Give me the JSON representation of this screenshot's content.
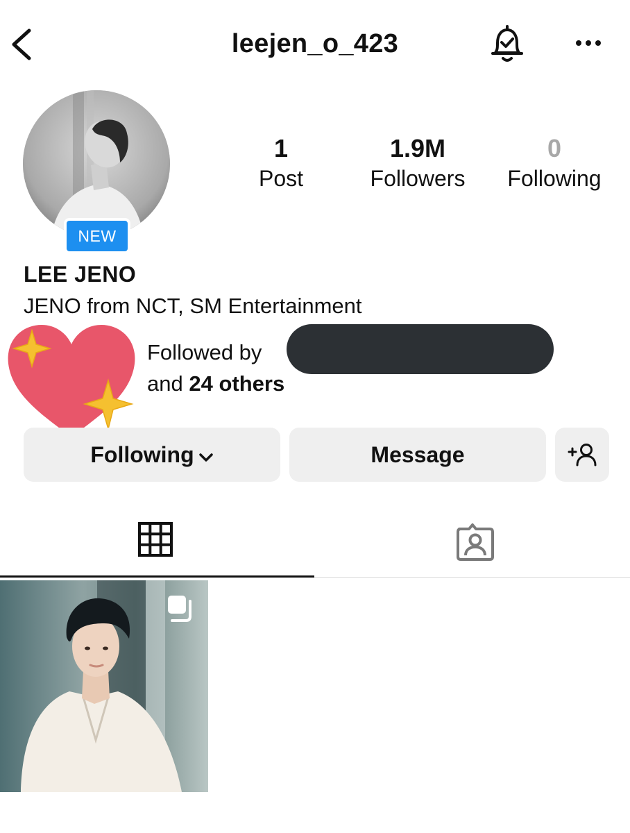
{
  "header": {
    "username": "leejen_o_423",
    "back_icon": "chevron-left-icon",
    "bell_icon": "notification-bell-check-icon",
    "more_icon": "more-horizontal-icon"
  },
  "profile": {
    "avatar_badge": "NEW",
    "display_name": "LEE JENO",
    "bio": "JENO from NCT, SM Entertainment"
  },
  "stats": {
    "posts": {
      "value": "1",
      "label": "Post"
    },
    "followers": {
      "value": "1.9M",
      "label": "Followers"
    },
    "following": {
      "value": "0",
      "label": "Following"
    }
  },
  "followed_by": {
    "prefix": "Followed by",
    "and_text": "and",
    "others_text": "24 others"
  },
  "actions": {
    "following_label": "Following",
    "message_label": "Message",
    "add_user_icon": "add-user-icon"
  },
  "tabs": [
    {
      "name": "posts",
      "icon": "grid-icon",
      "active": true
    },
    {
      "name": "tagged",
      "icon": "tagged-person-icon",
      "active": false
    }
  ],
  "colors": {
    "new_badge": "#1d8ff0",
    "button_bg": "#efefef",
    "redaction": "#2c3034",
    "heart": "#e8566a",
    "sparkle": "#f5c030"
  }
}
